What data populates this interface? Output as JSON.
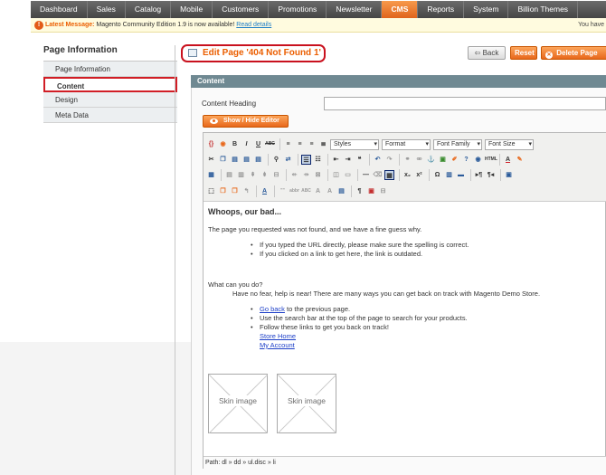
{
  "nav": {
    "items": [
      "Dashboard",
      "Sales",
      "Catalog",
      "Mobile",
      "Customers",
      "Promotions",
      "Newsletter",
      "CMS",
      "Reports",
      "System",
      "Billion Themes"
    ],
    "active": "CMS"
  },
  "message": {
    "title": "Latest Message:",
    "text": "Magento Community Edition 1.9 is now available!",
    "link": "Read details",
    "right": "You have"
  },
  "sidebar": {
    "title": "Page Information",
    "items": [
      "Page Information",
      "Content",
      "Design",
      "Meta Data"
    ],
    "active": "Content"
  },
  "header": {
    "title": "Edit Page '404 Not Found 1'",
    "back": "Back",
    "reset": "Reset",
    "delete": "Delete Page"
  },
  "section": {
    "title": "Content",
    "heading_label": "Content Heading",
    "heading_value": "",
    "toggle_editor": "Show / Hide Editor"
  },
  "toolbar": {
    "styles": "Styles",
    "format": "Format",
    "font_family": "Font Family",
    "font_size": "Font Size"
  },
  "editor": {
    "heading": "Whoops, our bad...",
    "p1": "The page you requested was not found, and we have a fine guess why.",
    "bullets1": [
      "If you typed the URL directly, please make sure the spelling is correct.",
      "If you clicked on a link to get here, the link is outdated."
    ],
    "p2": "What can you do?",
    "p3": "Have no fear, help is near! There are many ways you can get back on track with Magento Demo Store.",
    "go_back_link": "Go back",
    "go_back_text": " to the previous page.",
    "bullet_search": "Use the search bar at the top of the page to search for your products.",
    "bullet_follow": "Follow these links to get you back on track!",
    "link_store_home": "Store Home",
    "link_my_account": "My Account",
    "skin_image": "Skin image"
  },
  "path": "Path: dl » dd » ul.disc » li"
}
